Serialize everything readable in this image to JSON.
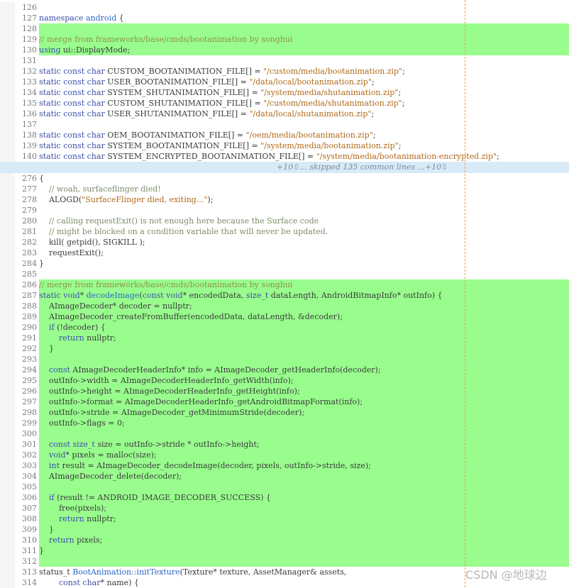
{
  "watermark": "CSDN @地球边",
  "separator_text": "+10⇧... skipped 135 common lines ...+10⇩",
  "lines_before": [
    {
      "num": "126",
      "text": "",
      "hl": false
    },
    {
      "num": "127",
      "text": "namespace android {",
      "hl": false
    },
    {
      "num": "128",
      "text": "",
      "hl": true
    },
    {
      "num": "129",
      "text": "// merge from frameworks/base/cmds/bootanimation by songhui",
      "hl": true
    },
    {
      "num": "130",
      "text": "using ui::DisplayMode;",
      "hl": true
    },
    {
      "num": "131",
      "text": "",
      "hl": false
    },
    {
      "num": "132",
      "text": "static const char CUSTOM_BOOTANIMATION_FILE[] = \"/custom/media/bootanimation.zip\";",
      "hl": false
    },
    {
      "num": "133",
      "text": "static const char USER_BOOTANIMATION_FILE[] = \"/data/local/bootanimation.zip\";",
      "hl": false
    },
    {
      "num": "134",
      "text": "static const char SYSTEM_SHUTANIMATION_FILE[] = \"/system/media/shutanimation.zip\";",
      "hl": false
    },
    {
      "num": "135",
      "text": "static const char CUSTOM_SHUTANIMATION_FILE[] = \"/custom/media/shutanimation.zip\";",
      "hl": false
    },
    {
      "num": "136",
      "text": "static const char USER_SHUTANIMATION_FILE[] = \"/data/local/shutanimation.zip\";",
      "hl": false
    },
    {
      "num": "137",
      "text": "",
      "hl": false
    },
    {
      "num": "138",
      "text": "static const char OEM_BOOTANIMATION_FILE[] = \"/oem/media/bootanimation.zip\";",
      "hl": false
    },
    {
      "num": "139",
      "text": "static const char SYSTEM_BOOTANIMATION_FILE[] = \"/system/media/bootanimation.zip\";",
      "hl": false
    },
    {
      "num": "140",
      "text": "static const char SYSTEM_ENCRYPTED_BOOTANIMATION_FILE[] = \"/system/media/bootanimation-encrypted.zip\";",
      "hl": false
    }
  ],
  "lines_after": [
    {
      "num": "276",
      "text": "{",
      "hl": false
    },
    {
      "num": "277",
      "text": "    // woah, surfaceflinger died!",
      "hl": false
    },
    {
      "num": "278",
      "text": "    ALOGD(\"SurfaceFlinger died, exiting...\");",
      "hl": false
    },
    {
      "num": "279",
      "text": "",
      "hl": false
    },
    {
      "num": "280",
      "text": "    // calling requestExit() is not enough here because the Surface code",
      "hl": false
    },
    {
      "num": "281",
      "text": "    // might be blocked on a condition variable that will never be updated.",
      "hl": false
    },
    {
      "num": "282",
      "text": "    kill( getpid(), SIGKILL );",
      "hl": false
    },
    {
      "num": "283",
      "text": "    requestExit();",
      "hl": false
    },
    {
      "num": "284",
      "text": "}",
      "hl": false
    },
    {
      "num": "285",
      "text": "",
      "hl": false
    },
    {
      "num": "286",
      "text": "// merge from frameworks/base/cmds/bootanimation by songhui",
      "hl": true
    },
    {
      "num": "287",
      "text": "static void* decodeImage(const void* encodedData, size_t dataLength, AndroidBitmapInfo* outInfo) {",
      "hl": true
    },
    {
      "num": "288",
      "text": "    AImageDecoder* decoder = nullptr;",
      "hl": true
    },
    {
      "num": "289",
      "text": "    AImageDecoder_createFromBuffer(encodedData, dataLength, &decoder);",
      "hl": true
    },
    {
      "num": "290",
      "text": "    if (!decoder) {",
      "hl": true
    },
    {
      "num": "291",
      "text": "        return nullptr;",
      "hl": true
    },
    {
      "num": "292",
      "text": "    }",
      "hl": true
    },
    {
      "num": "293",
      "text": "",
      "hl": true
    },
    {
      "num": "294",
      "text": "    const AImageDecoderHeaderInfo* info = AImageDecoder_getHeaderInfo(decoder);",
      "hl": true
    },
    {
      "num": "295",
      "text": "    outInfo->width = AImageDecoderHeaderInfo_getWidth(info);",
      "hl": true
    },
    {
      "num": "296",
      "text": "    outInfo->height = AImageDecoderHeaderInfo_getHeight(info);",
      "hl": true
    },
    {
      "num": "297",
      "text": "    outInfo->format = AImageDecoderHeaderInfo_getAndroidBitmapFormat(info);",
      "hl": true
    },
    {
      "num": "298",
      "text": "    outInfo->stride = AImageDecoder_getMinimumStride(decoder);",
      "hl": true
    },
    {
      "num": "299",
      "text": "    outInfo->flags = 0;",
      "hl": true
    },
    {
      "num": "300",
      "text": "",
      "hl": true
    },
    {
      "num": "301",
      "text": "    const size_t size = outInfo->stride * outInfo->height;",
      "hl": true
    },
    {
      "num": "302",
      "text": "    void* pixels = malloc(size);",
      "hl": true
    },
    {
      "num": "303",
      "text": "    int result = AImageDecoder_decodeImage(decoder, pixels, outInfo->stride, size);",
      "hl": true
    },
    {
      "num": "304",
      "text": "    AImageDecoder_delete(decoder);",
      "hl": true
    },
    {
      "num": "305",
      "text": "",
      "hl": true
    },
    {
      "num": "306",
      "text": "    if (result != ANDROID_IMAGE_DECODER_SUCCESS) {",
      "hl": true
    },
    {
      "num": "307",
      "text": "        free(pixels);",
      "hl": true
    },
    {
      "num": "308",
      "text": "        return nullptr;",
      "hl": true
    },
    {
      "num": "309",
      "text": "    }",
      "hl": true
    },
    {
      "num": "310",
      "text": "    return pixels;",
      "hl": true
    },
    {
      "num": "311",
      "text": "}",
      "hl": true
    },
    {
      "num": "312",
      "text": "",
      "hl": true
    },
    {
      "num": "313",
      "text": "status_t BootAnimation::initTexture(Texture* texture, AssetManager& assets,",
      "hl": false
    },
    {
      "num": "314",
      "text": "        const char* name) {",
      "hl": false
    }
  ]
}
